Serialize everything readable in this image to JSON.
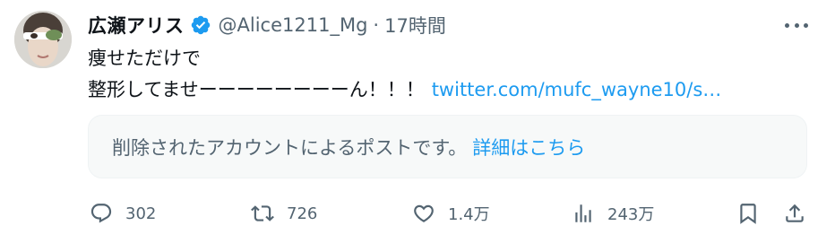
{
  "author": {
    "display_name": "広瀬アリス",
    "handle": "@Alice1211_Mg",
    "separator": "·",
    "time": "17時間",
    "verified_icon": "verified-badge-icon",
    "verified_color": "#1d9bf0"
  },
  "tweet": {
    "line1": "痩せただけで",
    "line2": "整形してませーーーーーーーーん！！！",
    "link": "twitter.com/mufc_wayne10/s…"
  },
  "quoted_card": {
    "message": "削除されたアカウントによるポストです。",
    "details_link": "詳細はこちら"
  },
  "actions": {
    "reply": {
      "icon": "reply-icon",
      "count": "302"
    },
    "retweet": {
      "icon": "retweet-icon",
      "count": "726"
    },
    "like": {
      "icon": "heart-icon",
      "count": "1.4万"
    },
    "views": {
      "icon": "views-icon",
      "count": "243万"
    },
    "bookmark": {
      "icon": "bookmark-icon"
    },
    "share": {
      "icon": "share-icon"
    }
  },
  "colors": {
    "text": "#0f1419",
    "secondary": "#536471",
    "accent": "#1d9bf0",
    "card_bg": "#f7f9f9"
  }
}
